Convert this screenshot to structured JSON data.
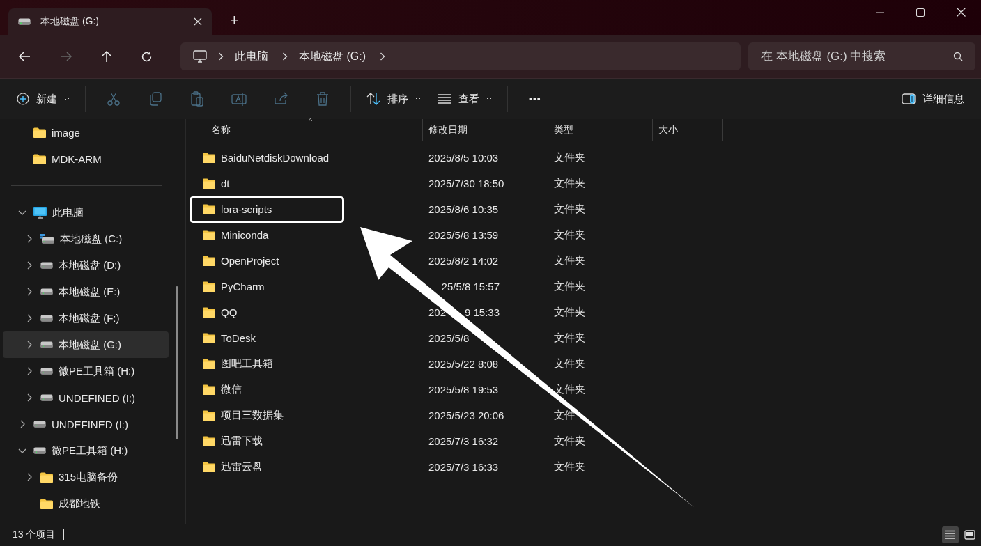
{
  "tabs": [
    {
      "title": "本地磁盘 (G:)",
      "selected": true
    }
  ],
  "new_tab": "+",
  "breadcrumb": [
    "此电脑",
    "本地磁盘 (G:)"
  ],
  "search": {
    "placeholder": "在 本地磁盘 (G:) 中搜索"
  },
  "toolbar": {
    "new": "新建",
    "actions": [
      {
        "kind": "cut",
        "disabled": true
      },
      {
        "kind": "copy",
        "disabled": true
      },
      {
        "kind": "paste",
        "disabled": true
      },
      {
        "kind": "rename",
        "disabled": true
      },
      {
        "kind": "share",
        "disabled": true
      },
      {
        "kind": "delete",
        "disabled": true
      }
    ],
    "sort": "排序",
    "view": "查看",
    "more": "•••",
    "details": "详细信息"
  },
  "sidebar": {
    "items": [
      {
        "label": "image",
        "kind": "folder",
        "selected": false
      },
      {
        "label": "MDK-ARM",
        "kind": "folder",
        "selected": false
      },
      {
        "kind": "divider"
      },
      {
        "label": "此电脑",
        "kind": "pc",
        "expanded": true,
        "selected": false,
        "children": [
          {
            "label": "本地磁盘 (C:)",
            "kind": "system-drive",
            "expanded": false,
            "selected": false
          },
          {
            "label": "本地磁盘 (D:)",
            "kind": "drive",
            "expanded": false,
            "selected": false
          },
          {
            "label": "本地磁盘 (E:)",
            "kind": "drive",
            "expanded": false,
            "selected": false
          },
          {
            "label": "本地磁盘 (F:)",
            "kind": "drive",
            "expanded": false,
            "selected": false
          },
          {
            "label": "本地磁盘 (G:)",
            "kind": "drive",
            "expanded": false,
            "selected": true
          },
          {
            "label": "微PE工具箱 (H:)",
            "kind": "drive",
            "expanded": false,
            "selected": false
          },
          {
            "label": "UNDEFINED (I:)",
            "kind": "drive",
            "expanded": false,
            "selected": false
          }
        ]
      },
      {
        "label": "UNDEFINED (I:)",
        "kind": "drive",
        "expanded": false,
        "selected": false
      },
      {
        "label": "微PE工具箱 (H:)",
        "kind": "drive",
        "expanded": true,
        "selected": false,
        "children": [
          {
            "label": "315电脑备份",
            "kind": "folder",
            "expanded": false,
            "selected": false
          },
          {
            "label": "成都地铁",
            "kind": "folder",
            "selected": false
          }
        ]
      }
    ]
  },
  "table": {
    "columns": [
      {
        "label": "名称",
        "sorted": true
      },
      {
        "label": "修改日期",
        "sorted": false
      },
      {
        "label": "类型",
        "sorted": false
      },
      {
        "label": "大小",
        "sorted": false
      }
    ],
    "sort_indicator": "^",
    "rows": [
      {
        "name": "BaiduNetdiskDownload",
        "date": "2025/8/5 10:03",
        "type": "文件夹",
        "highlighted": false
      },
      {
        "name": "dt",
        "date": "2025/7/30 18:50",
        "type": "文件夹",
        "highlighted": false
      },
      {
        "name": "lora-scripts",
        "date": "2025/8/6 10:35",
        "type": "文件夹",
        "highlighted": true
      },
      {
        "name": "Miniconda",
        "date": "2025/5/8 13:59",
        "type": "文件夹",
        "highlighted": false
      },
      {
        "name": "OpenProject",
        "date": "2025/8/2 14:02",
        "type": "文件夹",
        "highlighted": false
      },
      {
        "name": "PyCharm",
        "date": "25/5/8 15:57",
        "start_covered": true,
        "type": "文件夹",
        "highlighted": false
      },
      {
        "name": "QQ",
        "date": [
          "202",
          "9 15:33"
        ],
        "type": "文件夹",
        "highlighted": false
      },
      {
        "name": "ToDesk",
        "date": "2025/5/8",
        "type": "文件夹",
        "highlighted": false
      },
      {
        "name": "图吧工具箱",
        "date": "2025/5/22 8:08",
        "type": "文件夹",
        "highlighted": false
      },
      {
        "name": "微信",
        "date": "2025/5/8 19:53",
        "type": "文件夹",
        "highlighted": false
      },
      {
        "name": "项目三数据集",
        "date": "2025/5/23 20:06",
        "type": "文件",
        "highlighted": false
      },
      {
        "name": "迅雷下载",
        "date": "2025/7/3 16:32",
        "type": "文件夹",
        "highlighted": false
      },
      {
        "name": "迅雷云盘",
        "date": "2025/7/3 16:33",
        "type": "文件夹",
        "highlighted": false
      }
    ]
  },
  "status_bar": {
    "count": "13 个项目",
    "views": [
      {
        "kind": "details",
        "selected": true
      },
      {
        "kind": "tiles",
        "selected": false
      }
    ]
  }
}
